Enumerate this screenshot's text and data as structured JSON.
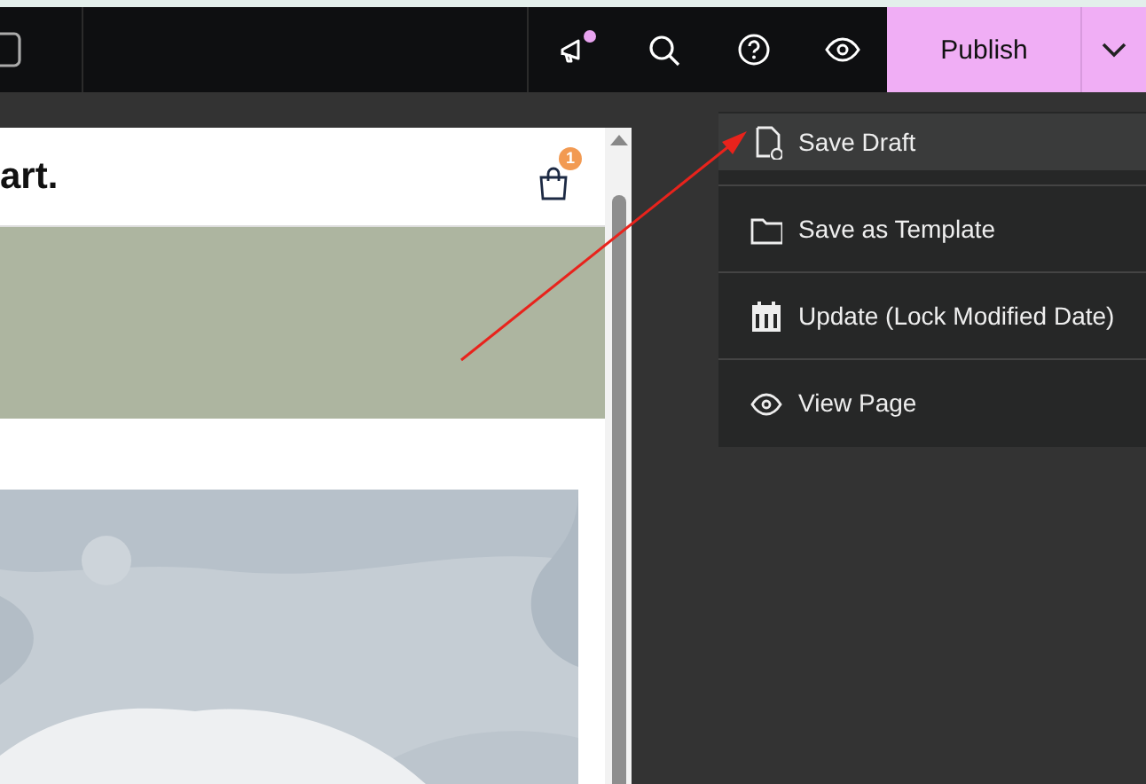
{
  "toolbar": {
    "device": {
      "kind": "phone"
    },
    "actions": [
      {
        "kind": "megaphone",
        "notification": true
      },
      {
        "kind": "search",
        "notification": false
      },
      {
        "kind": "help",
        "notification": false
      },
      {
        "kind": "preview",
        "notification": false
      }
    ],
    "publish": {
      "label": "Publish"
    }
  },
  "preview": {
    "logo": "art.",
    "cart_count": "1"
  },
  "menu": {
    "items": [
      {
        "label": "Save Draft",
        "kind": "draft",
        "selected": true
      },
      {
        "label": "Save as Template",
        "kind": "template",
        "selected": false
      },
      {
        "label": "Update (Lock Modified Date)",
        "kind": "update",
        "selected": false
      },
      {
        "label": "View Page",
        "kind": "view",
        "selected": false
      }
    ]
  }
}
